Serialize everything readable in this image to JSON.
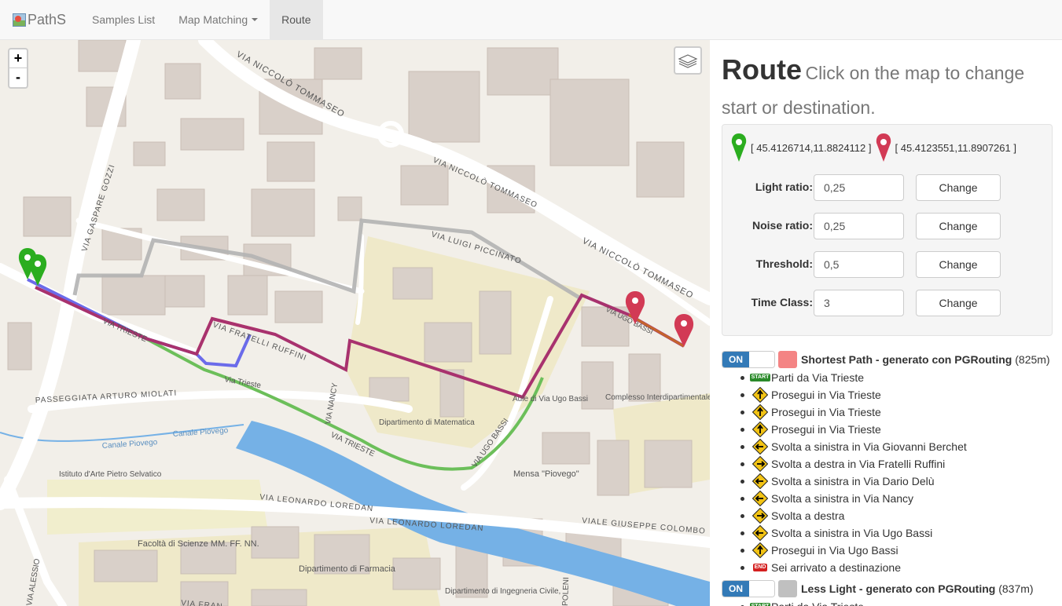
{
  "nav": {
    "brand": "PathS",
    "items": [
      "Samples List",
      "Map Matching",
      "Route"
    ]
  },
  "map": {
    "zoom_in": "+",
    "zoom_out": "-",
    "labels": {
      "via_niccolo_tommaseo_1": "VIA NICCOLÒ TOMMASEO",
      "via_niccolo_tommaseo_2": "VIA NICCOLÒ TOMMASEO",
      "via_niccolo_tommaseo_3": "VIA NICCOLÒ TOMMASEO",
      "via_gaspare_gozzi": "VIA GASPARE GOZZI",
      "via_luigi_piccinato": "VIA LUIGI PICCINATO",
      "via_fratelli_ruffini": "VIA FRATELLI RUFFINI",
      "via_trieste_upper": "VIA TRIESTE",
      "via_trieste_small": "Via Trieste",
      "via_nancy": "VIA NANCY",
      "via_ugo_bassi_upper": "VIA UGO BASSI",
      "via_ugo_bassi_low": "VIA UGO BASSI",
      "passeggiata": "PASSEGGIATA ARTURO MIOLATI",
      "dip_matematica": "Dipartimento di Matematica",
      "aule": "Aule di Via Ugo Bassi",
      "complesso": "Complesso Interdipartimentale Biologico-Medico \"A. Vallisneri\"",
      "canale": "Canale Piovego",
      "canale2": "Canale Piovego",
      "istituto": "Istituto d'Arte Pietro Selvatico",
      "via_loredan_1": "VIA LEONARDO LOREDAN",
      "via_loredan_2": "VIA LEONARDO LOREDAN",
      "via_loredan_3": "VIA LEONARDO LOREDAN",
      "mensa": "Mensa \"Piovego\"",
      "viale_colombo": "VIALE GIUSEPPE COLOMBO",
      "facolta": "Facoltà di Scienze MM. FF. NN.",
      "dip_farmacia": "Dipartimento di Farmacia",
      "dip_ingegneria": "Dipartimento di Ingegneria Civile,",
      "via_alessio": "VIA ALESSIO",
      "via_fra": "VIA FRAN",
      "poleni": "POLENI",
      "via_trieste_river": "VIA TRIESTE"
    }
  },
  "panel": {
    "title": "Route",
    "subtitle": "Click on the map to change start or destination.",
    "start_coords": "[ 45.4126714,11.8824112 ]",
    "end_coords": "[ 45.4123551,11.8907261 ]",
    "params": [
      {
        "label": "Light ratio:",
        "value": "0,25",
        "button": "Change"
      },
      {
        "label": "Noise ratio:",
        "value": "0,25",
        "button": "Change"
      },
      {
        "label": "Threshold:",
        "value": "0,5",
        "button": "Change"
      },
      {
        "label": "Time Class:",
        "value": "3",
        "button": "Change"
      }
    ],
    "routes": [
      {
        "toggle": "ON",
        "color": "#f48484",
        "name": "Shortest Path - generato con PGRouting",
        "length": "(825m)",
        "steps": [
          {
            "icon": "start",
            "badge": "START",
            "text": "Parti da Via Trieste"
          },
          {
            "icon": "straight",
            "text": "Prosegui in Via Trieste"
          },
          {
            "icon": "straight",
            "text": "Prosegui in Via Trieste"
          },
          {
            "icon": "straight",
            "text": "Prosegui in Via Trieste"
          },
          {
            "icon": "left",
            "text": "Svolta a sinistra in Via Giovanni Berchet"
          },
          {
            "icon": "right",
            "text": "Svolta a destra in Via Fratelli Ruffini"
          },
          {
            "icon": "left",
            "text": "Svolta a sinistra in Via Dario Delù"
          },
          {
            "icon": "left",
            "text": "Svolta a sinistra in Via Nancy"
          },
          {
            "icon": "right",
            "text": "Svolta a destra"
          },
          {
            "icon": "left",
            "text": "Svolta a sinistra in Via Ugo Bassi"
          },
          {
            "icon": "straight",
            "text": "Prosegui in Via Ugo Bassi"
          },
          {
            "icon": "end",
            "badge": "END",
            "text": "Sei arrivato a destinazione"
          }
        ]
      },
      {
        "toggle": "ON",
        "color": "#c0c0c0",
        "name": "Less Light - generato con PGRouting",
        "length": "(837m)",
        "steps": [
          {
            "icon": "start",
            "badge": "START",
            "text": "Parti da Via Trieste"
          }
        ]
      }
    ]
  },
  "colors": {
    "route_purple": "#a8326e",
    "route_green": "#6cbf5a",
    "route_blue": "#6b6bea",
    "route_red": "#f06060",
    "route_gray": "#b3b3b3",
    "start_marker": "#2bad1f",
    "end_marker": "#d23a55",
    "water": "#75b1e6"
  }
}
